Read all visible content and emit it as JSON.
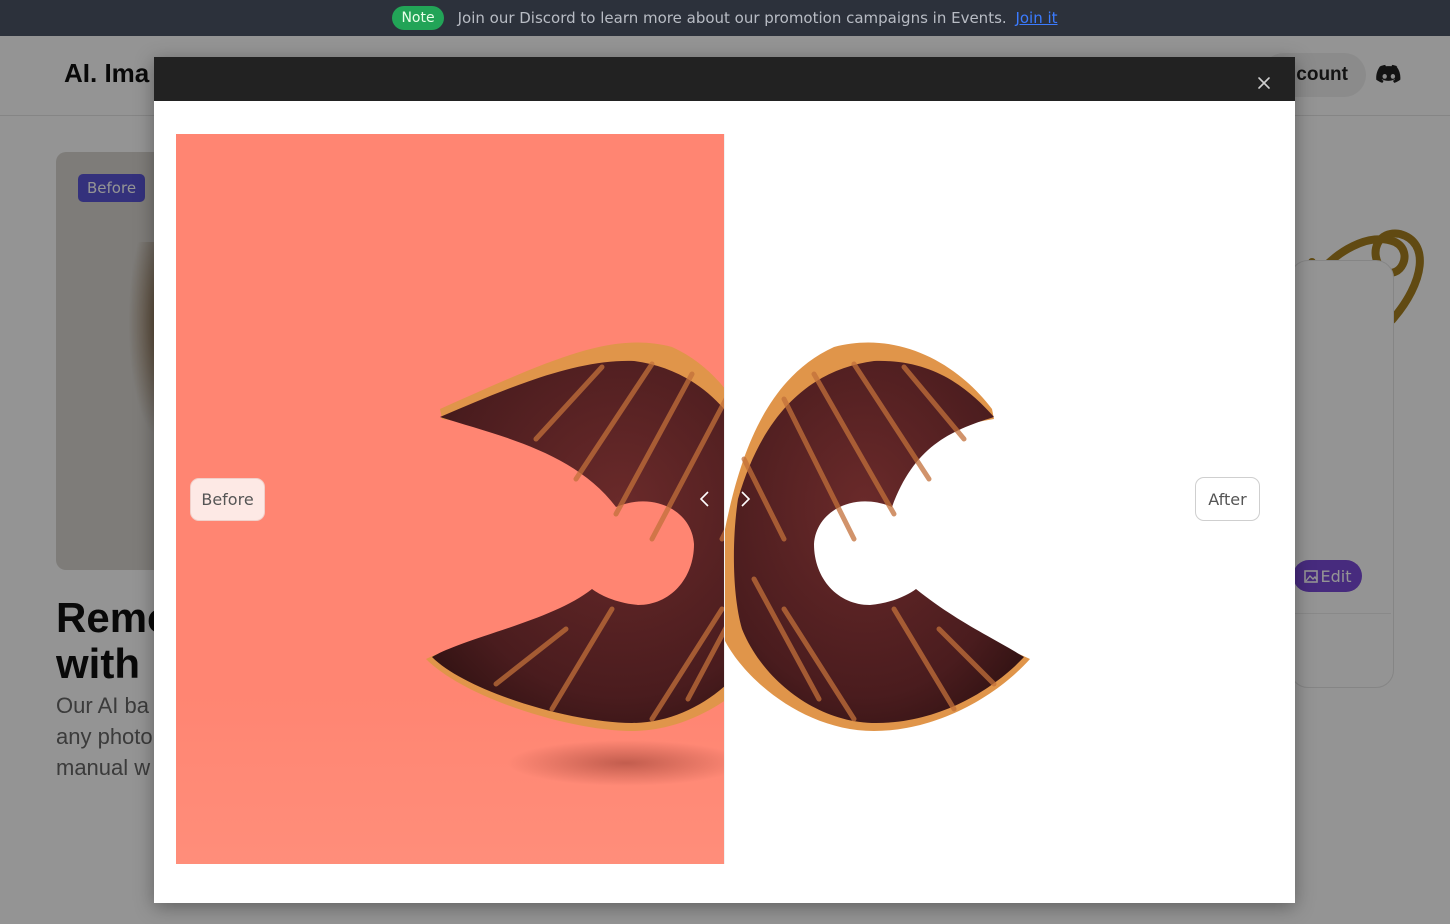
{
  "notice": {
    "badge": "Note",
    "text": "Join our Discord to learn more about our promotion campaigns in Events.",
    "link": "Join it"
  },
  "header": {
    "logo": "AI. Ima",
    "account_label": "count"
  },
  "hero": {
    "before_tag": "Before",
    "title_line1": "Remo",
    "title_line2": "with",
    "sub_line1": "Our AI ba",
    "sub_line2": "any photo",
    "sub_line3": "manual w"
  },
  "side_card": {
    "edit_label": "Edit"
  },
  "modal": {
    "before_label": "Before",
    "after_label": "After"
  },
  "colors": {
    "before_background": "#ff8572",
    "after_background": "#ffffff",
    "modal_header": "#222222",
    "notice_bar": "#2c313b",
    "note_badge": "#22a457",
    "link": "#3b7bff"
  }
}
